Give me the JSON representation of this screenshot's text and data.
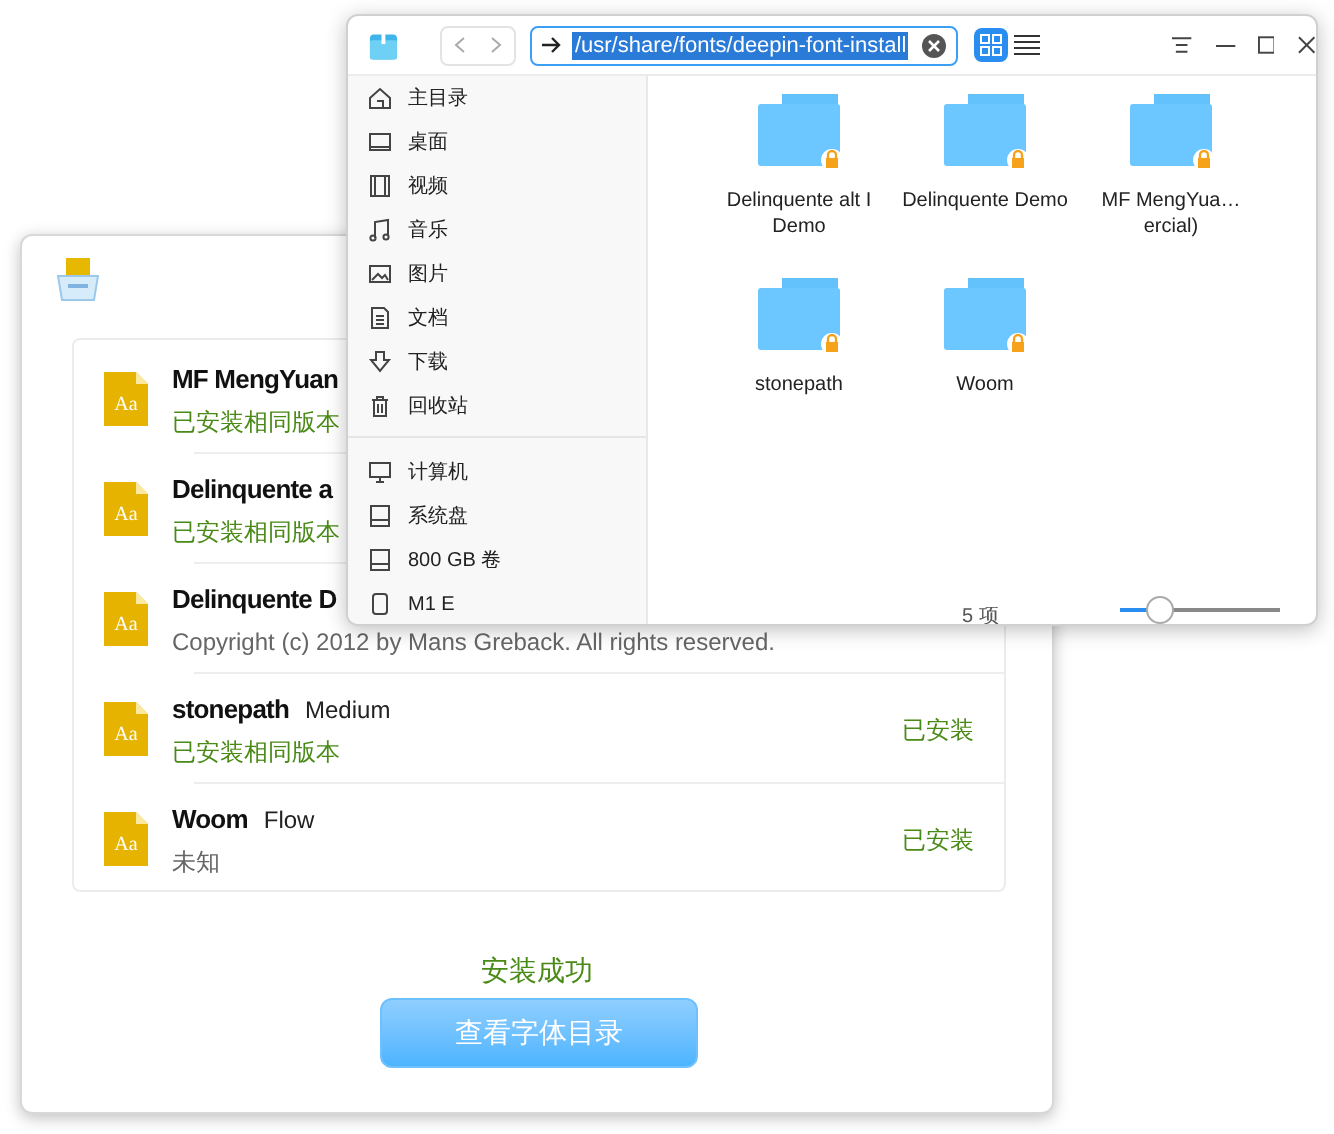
{
  "installer": {
    "fonts": [
      {
        "icon_text": "Aa",
        "name": "MF MengYuan",
        "detail": "已安装相同版本",
        "kind": "installed"
      },
      {
        "icon_text": "Aa",
        "name": "Delinquente a",
        "detail": "已安装相同版本",
        "kind": "installed"
      },
      {
        "icon_text": "Aa",
        "name": "Delinquente D",
        "detail": "Copyright (c) 2012 by Mans Greback. All rights reserved.",
        "kind": "info"
      },
      {
        "icon_text": "Aa",
        "name": "stonepath",
        "style": "Medium",
        "detail": "已安装相同版本",
        "kind": "installed",
        "status": "已安装"
      },
      {
        "icon_text": "Aa",
        "name": "Woom",
        "style": "Flow",
        "detail": "未知",
        "kind": "info",
        "status": "已安装"
      }
    ],
    "result": "安装成功",
    "button": "查看字体目录"
  },
  "file_manager": {
    "address": "/usr/share/fonts/deepin-font-install",
    "view_modes": [
      {
        "kind": "grid",
        "selected": true
      },
      {
        "kind": "list",
        "selected": false
      }
    ],
    "sidebar": [
      [
        {
          "kind": "home",
          "label": "主目录"
        },
        {
          "kind": "desktop",
          "label": "桌面"
        },
        {
          "kind": "video",
          "label": "视频"
        },
        {
          "kind": "music",
          "label": "音乐"
        },
        {
          "kind": "picture",
          "label": "图片"
        },
        {
          "kind": "document",
          "label": "文档"
        },
        {
          "kind": "download",
          "label": "下载"
        },
        {
          "kind": "trash",
          "label": "回收站"
        }
      ],
      [
        {
          "kind": "computer",
          "label": "计算机"
        },
        {
          "kind": "disk",
          "label": "系统盘"
        },
        {
          "kind": "disk",
          "label": "800 GB 卷"
        },
        {
          "kind": "phone",
          "label": "M1 E"
        }
      ]
    ],
    "folders": [
      {
        "name": "Delinquente alt I Demo",
        "locked": true
      },
      {
        "name": "Delinquente Demo",
        "locked": true
      },
      {
        "name": "MF MengYua…ercial)",
        "locked": true
      },
      {
        "name": "stonepath",
        "locked": true
      },
      {
        "name": "Woom",
        "locked": true
      }
    ],
    "item_count": "5 项",
    "zoom": {
      "level": 0.25
    }
  }
}
